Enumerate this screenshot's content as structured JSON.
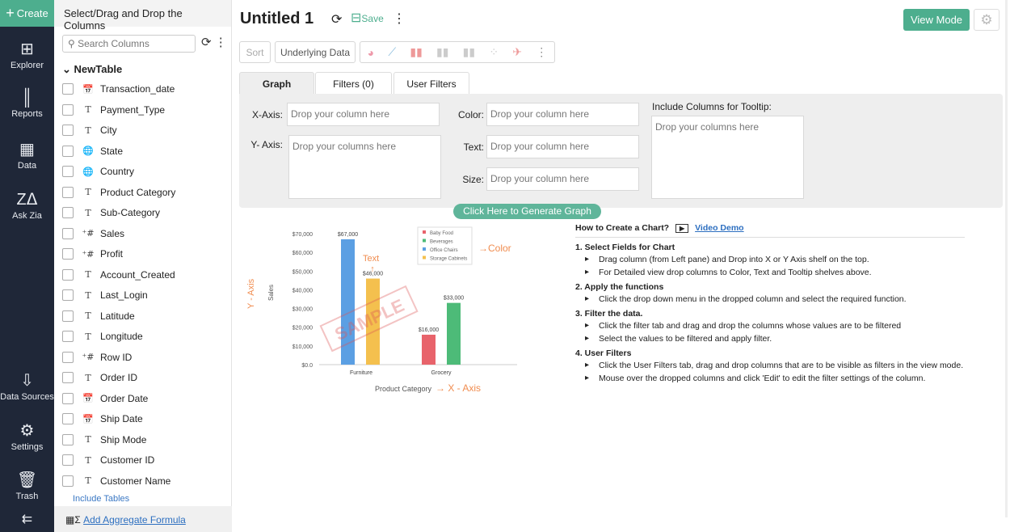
{
  "nav": {
    "create": "Create",
    "items": [
      {
        "label": "Explorer",
        "icon": "explorer-icon",
        "glyph": "⊞"
      },
      {
        "label": "Reports",
        "icon": "reports-icon",
        "glyph": "║"
      },
      {
        "label": "Data",
        "icon": "data-icon",
        "glyph": "▦"
      },
      {
        "label": "Ask Zia",
        "icon": "zia-icon",
        "glyph": "Zᐃ"
      },
      {
        "label": "Data Sources",
        "icon": "data-sources-icon",
        "glyph": "⇩"
      },
      {
        "label": "Settings",
        "icon": "settings-icon",
        "glyph": "⚙"
      },
      {
        "label": "Trash",
        "icon": "trash-icon",
        "glyph": "🗑"
      }
    ],
    "collapse": "⇇"
  },
  "columns": {
    "header": "Select/Drag and Drop the Columns",
    "search_placeholder": "Search Columns",
    "table": "NewTable",
    "items": [
      {
        "name": "Transaction_date",
        "type": "date"
      },
      {
        "name": "Payment_Type",
        "type": "text"
      },
      {
        "name": "City",
        "type": "text"
      },
      {
        "name": "State",
        "type": "geo"
      },
      {
        "name": "Country",
        "type": "geo"
      },
      {
        "name": "Product Category",
        "type": "text"
      },
      {
        "name": "Sub-Category",
        "type": "text"
      },
      {
        "name": "Sales",
        "type": "number"
      },
      {
        "name": "Profit",
        "type": "number"
      },
      {
        "name": "Account_Created",
        "type": "text"
      },
      {
        "name": "Last_Login",
        "type": "text"
      },
      {
        "name": "Latitude",
        "type": "text"
      },
      {
        "name": "Longitude",
        "type": "text"
      },
      {
        "name": "Row ID",
        "type": "number"
      },
      {
        "name": "Order ID",
        "type": "text"
      },
      {
        "name": "Order Date",
        "type": "date"
      },
      {
        "name": "Ship Date",
        "type": "date"
      },
      {
        "name": "Ship Mode",
        "type": "text"
      },
      {
        "name": "Customer ID",
        "type": "text"
      },
      {
        "name": "Customer Name",
        "type": "text"
      }
    ],
    "include_tables": "Include Tables",
    "add_formula": "Add Aggregate Formula"
  },
  "header": {
    "title": "Untitled 1",
    "save": "Save",
    "view_mode": "View Mode",
    "accent": "#4dae8e"
  },
  "toolbar": {
    "sort": "Sort",
    "underlying": "Underlying Data"
  },
  "tabs": [
    {
      "label": "Graph",
      "active": true
    },
    {
      "label": "Filters (0)"
    },
    {
      "label": "User Filters"
    }
  ],
  "shelves": {
    "x_label": "X-Axis:",
    "x_ph": "Drop your column here",
    "y_label": "Y- Axis:",
    "y_ph": "Drop your columns here",
    "color_label": "Color:",
    "color_ph": "Drop your column here",
    "text_label": "Text:",
    "text_ph": "Drop your column here",
    "size_label": "Size:",
    "size_ph": "Drop your column here",
    "tooltip_label": "Include Columns for Tooltip:",
    "tooltip_ph": "Drop your columns here",
    "generate": "Click Here to Generate Graph"
  },
  "help": {
    "title": "How to Create a Chart?",
    "video": "Video Demo",
    "sections": [
      {
        "h": "1. Select Fields for Chart",
        "items": [
          "Drag column (from Left pane) and Drop into X or Y Axis shelf on the top.",
          "For Detailed view drop columns to Color, Text and Tooltip shelves above."
        ]
      },
      {
        "h": "2. Apply the functions",
        "items": [
          "Click the drop down menu in the dropped column and select the required function."
        ]
      },
      {
        "h": "3. Filter the data.",
        "items": [
          "Click the filter tab and drag and drop the columns whose values are to be filtered",
          "Select the values to be filtered and apply filter."
        ]
      },
      {
        "h": "4. User Filters",
        "items": [
          "Click the User Filters tab, drag and drop columns that are to be visible as filters in the view mode.",
          "Mouse over the dropped columns and click 'Edit' to edit the filter settings of the column."
        ]
      }
    ]
  },
  "chart_data": {
    "type": "bar",
    "categories": [
      "Furniture",
      "Grocery"
    ],
    "xlabel": "Product Category",
    "ylabel": "Sales",
    "ylim": [
      0,
      70000
    ],
    "yticks": [
      "$0.0",
      "$10,000",
      "$20,000",
      "$30,000",
      "$40,000",
      "$50,000",
      "$60,000",
      "$70,000"
    ],
    "bars": [
      {
        "category": "Furniture",
        "series": "Office Chairs",
        "value": 67000,
        "label": "$67,000"
      },
      {
        "category": "Furniture",
        "series": "Storage Cabinets",
        "value": 46000,
        "label": "$46,000"
      },
      {
        "category": "Grocery",
        "series": "Baby Food",
        "value": 16000,
        "label": "$16,000"
      },
      {
        "category": "Grocery",
        "series": "Beverages",
        "value": 33000,
        "label": "$33,000"
      }
    ],
    "legend": [
      {
        "name": "Baby Food",
        "color": "#e8636b"
      },
      {
        "name": "Beverages",
        "color": "#4dbb78"
      },
      {
        "name": "Office Chairs",
        "color": "#5b9fe3"
      },
      {
        "name": "Storage Cabinets",
        "color": "#f4c04e"
      }
    ],
    "legend_position": "top-right",
    "annotations": {
      "color": "→Color",
      "text": "Text",
      "yaxis": "Y - Axis",
      "xaxis": "→ X - Axis",
      "watermark": "SAMPLE"
    }
  }
}
